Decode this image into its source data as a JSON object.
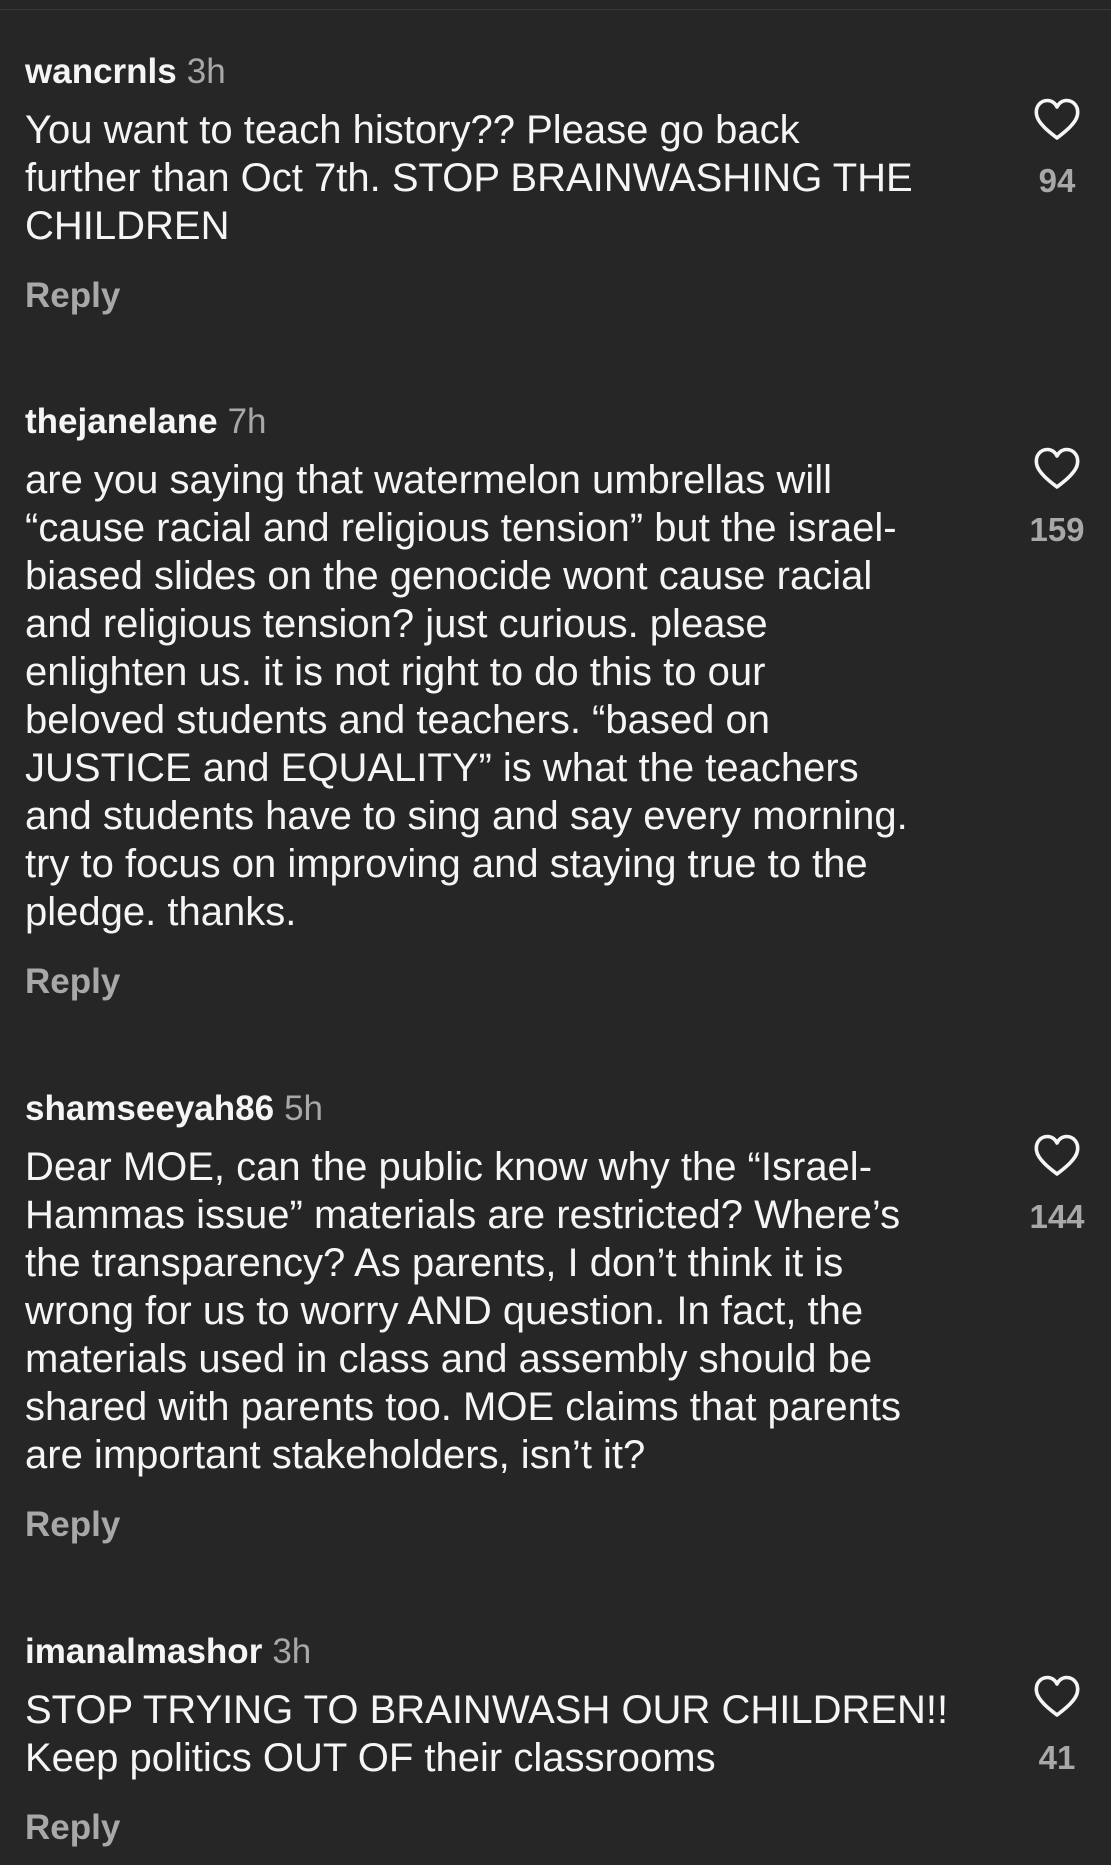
{
  "comments": [
    {
      "username": "wancrnls",
      "time": "3h",
      "text": "You want to teach history?? Please go back\nfurther than Oct 7th. STOP BRAINWASHING THE\nCHILDREN",
      "likes": "94",
      "reply_label": "Reply"
    },
    {
      "username": "thejanelane",
      "time": "7h",
      "text": "are you saying that watermelon umbrellas will\n“cause racial and religious tension” but the israel-\nbiased slides on the genocide wont cause racial\nand religious tension? just curious. please\nenlighten us. it is not right to do this to our\nbeloved students and teachers. “based on\nJUSTICE and EQUALITY” is what the teachers\nand students have to sing and say every morning.\ntry to focus on improving and staying true to the\npledge. thanks.",
      "likes": "159",
      "reply_label": "Reply"
    },
    {
      "username": "shamseeyah86",
      "time": "5h",
      "text": "Dear MOE, can the public know why the “Israel-\nHammas issue” materials are restricted? Where’s\nthe transparency? As parents, I don’t think it is\nwrong for us to worry AND question. In fact, the\nmaterials used in class and assembly should be\nshared with parents too. MOE claims that parents\nare important stakeholders, isn’t it?",
      "likes": "144",
      "reply_label": "Reply"
    },
    {
      "username": "imanalmashor",
      "time": "3h",
      "text": "STOP TRYING TO BRAINWASH OUR CHILDREN!!\nKeep politics OUT OF their classrooms",
      "likes": "41",
      "reply_label": "Reply"
    }
  ],
  "icons": {
    "like": "heart-outline-icon"
  },
  "colors": {
    "background": "#262626",
    "primary_text": "#f5f5f5",
    "secondary_text": "#a8a8a8"
  }
}
